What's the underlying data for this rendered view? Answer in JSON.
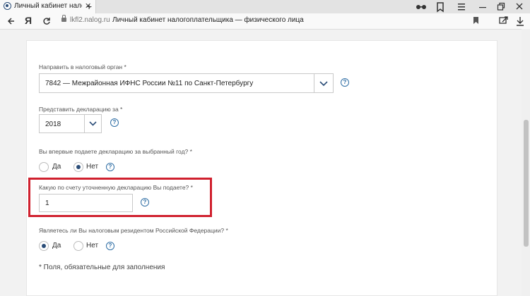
{
  "browser": {
    "tab_title": "Личный кабинет налогопл",
    "close_glyph": "✕",
    "new_tab_glyph": "+",
    "brand": "Я",
    "domain": "lkfl2.nalog.ru",
    "page_title": "Личный кабинет налогоплательщика — физического лица"
  },
  "form": {
    "tax_office": {
      "label": "Направить в налоговый орган *",
      "value": "7842 — Межрайонная ИФНС России №11 по Санкт-Петербургу"
    },
    "year": {
      "label": "Представить декларацию за *",
      "value": "2018"
    },
    "first_time": {
      "label": "Вы впервые подаете декларацию за выбранный год? *",
      "options": [
        "Да",
        "Нет"
      ],
      "selected": "Нет"
    },
    "correction_number": {
      "label": "Какую по счету уточненную декларацию Вы подаете? *",
      "value": "1"
    },
    "resident": {
      "label": "Являетесь ли Вы налоговым резидентом Российской Федерации? *",
      "options": [
        "Да",
        "Нет"
      ],
      "selected": "Да"
    },
    "help_glyph": "?",
    "footnote": "* Поля, обязательные для заполнения"
  },
  "colors": {
    "accent": "#2b4d78",
    "help": "#2f6ea5",
    "highlight": "#d0202e"
  }
}
